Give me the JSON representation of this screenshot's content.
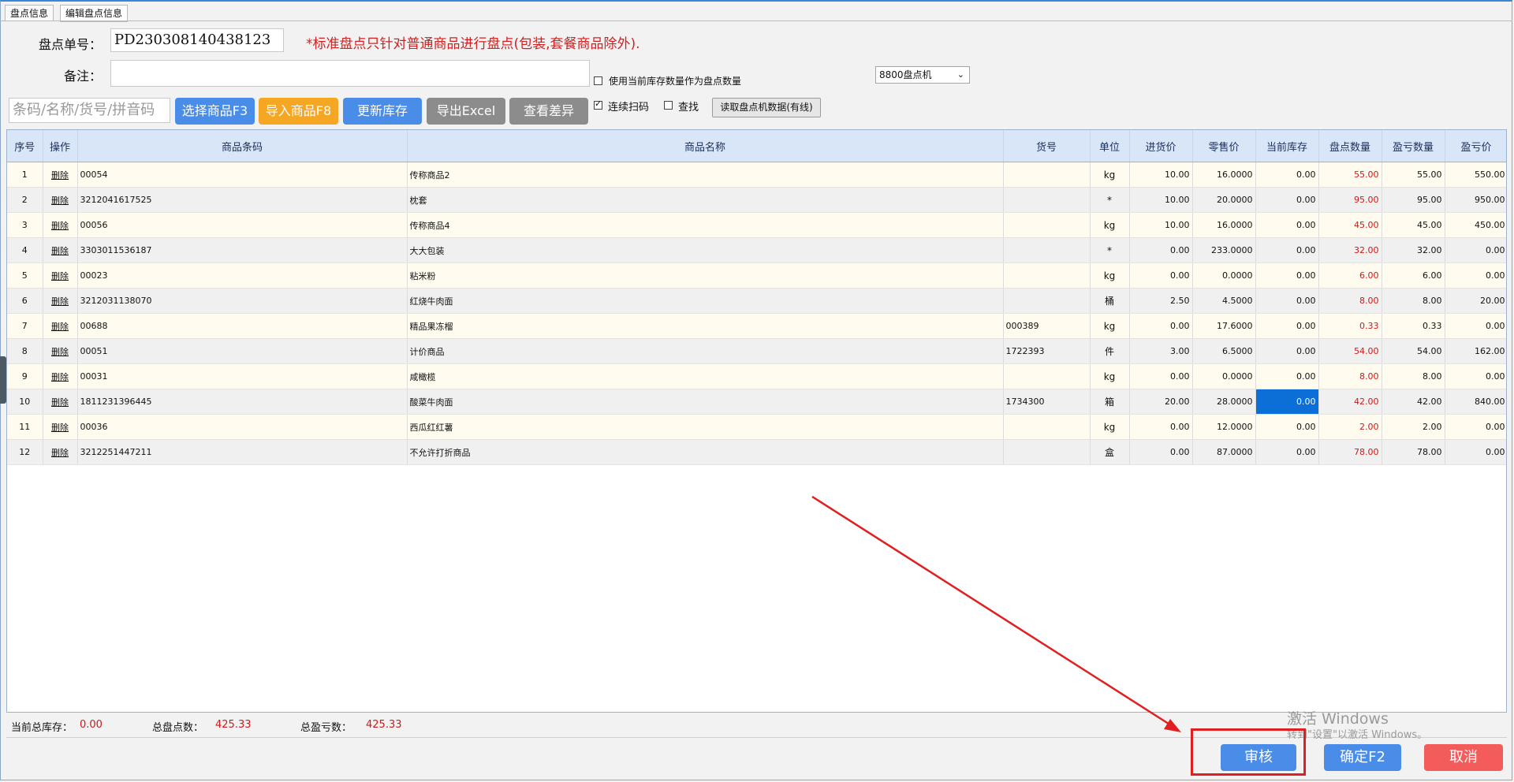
{
  "tabs": [
    "盘点信息",
    "编辑盘点信息"
  ],
  "form": {
    "order_label": "盘点单号：",
    "order_no": "PD230308140438123",
    "warning": "*标准盘点只针对普通商品进行盘点(包装,套餐商品除外).",
    "remark_label": "备注：",
    "remark_value": "",
    "use_stock_label": "使用当前库存数量作为盘点数量",
    "device_select": "8800盘点机",
    "search_placeholder": "条码/名称/货号/拼音码"
  },
  "toolbar": {
    "select_goods": "选择商品F3",
    "import_goods": "导入商品F8",
    "update_stock": "更新库存",
    "export_excel": "导出Excel",
    "view_diff": "查看差异",
    "continuous_scan": "连续扫码",
    "find": "查找",
    "read_device": "读取盘点机数据(有线)"
  },
  "colors": {
    "primary": "#4a8de8",
    "orange": "#f5a623",
    "gray": "#8c8c8c",
    "danger": "#f45c5c",
    "accent_red": "#cc1a1a"
  },
  "table": {
    "headers": [
      "序号",
      "操作",
      "商品条码",
      "商品名称",
      "货号",
      "单位",
      "进货价",
      "零售价",
      "当前库存",
      "盘点数量",
      "盈亏数量",
      "盈亏价"
    ],
    "rows": [
      [
        "1",
        "删除",
        "00054",
        "传称商品2",
        "",
        "kg",
        "10.00",
        "16.0000",
        "0.00",
        "55.00",
        "55.00",
        "550.00"
      ],
      [
        "2",
        "删除",
        "3212041617525",
        "枕套",
        "",
        "*",
        "10.00",
        "20.0000",
        "0.00",
        "95.00",
        "95.00",
        "950.00"
      ],
      [
        "3",
        "删除",
        "00056",
        "传称商品4",
        "",
        "kg",
        "10.00",
        "16.0000",
        "0.00",
        "45.00",
        "45.00",
        "450.00"
      ],
      [
        "4",
        "删除",
        "3303011536187",
        "大大包装",
        "",
        "*",
        "0.00",
        "233.0000",
        "0.00",
        "32.00",
        "32.00",
        "0.00"
      ],
      [
        "5",
        "删除",
        "00023",
        "粘米粉",
        "",
        "kg",
        "0.00",
        "0.0000",
        "0.00",
        "6.00",
        "6.00",
        "0.00"
      ],
      [
        "6",
        "删除",
        "3212031138070",
        "红烧牛肉面",
        "",
        "桶",
        "2.50",
        "4.5000",
        "0.00",
        "8.00",
        "8.00",
        "20.00"
      ],
      [
        "7",
        "删除",
        "00688",
        "精品果冻榴",
        "000389",
        "kg",
        "0.00",
        "17.6000",
        "0.00",
        "0.33",
        "0.33",
        "0.00"
      ],
      [
        "8",
        "删除",
        "00051",
        "计价商品",
        "1722393",
        "件",
        "3.00",
        "6.5000",
        "0.00",
        "54.00",
        "54.00",
        "162.00"
      ],
      [
        "9",
        "删除",
        "00031",
        "咸橄榄",
        "",
        "kg",
        "0.00",
        "0.0000",
        "0.00",
        "8.00",
        "8.00",
        "0.00"
      ],
      [
        "10",
        "删除",
        "1811231396445",
        "酸菜牛肉面",
        "1734300",
        "箱",
        "20.00",
        "28.0000",
        "0.00",
        "42.00",
        "42.00",
        "840.00"
      ],
      [
        "11",
        "删除",
        "00036",
        "西瓜红红薯",
        "",
        "kg",
        "0.00",
        "12.0000",
        "0.00",
        "2.00",
        "2.00",
        "0.00"
      ],
      [
        "12",
        "删除",
        "3212251447211",
        "不允许打折商品",
        "",
        "盒",
        "0.00",
        "87.0000",
        "0.00",
        "78.00",
        "78.00",
        "0.00"
      ]
    ]
  },
  "summary": {
    "stock_label": "当前总库存：",
    "stock_value": "0.00",
    "count_label": "总盘点数：",
    "count_value": "425.33",
    "profit_label": "总盈亏数：",
    "profit_value": "425.33"
  },
  "footer": {
    "audit": "审核",
    "confirm": "确定F2",
    "cancel": "取消"
  },
  "watermark": {
    "line1": "激活 Windows",
    "line2": "转到\"设置\"以激活 Windows。"
  }
}
